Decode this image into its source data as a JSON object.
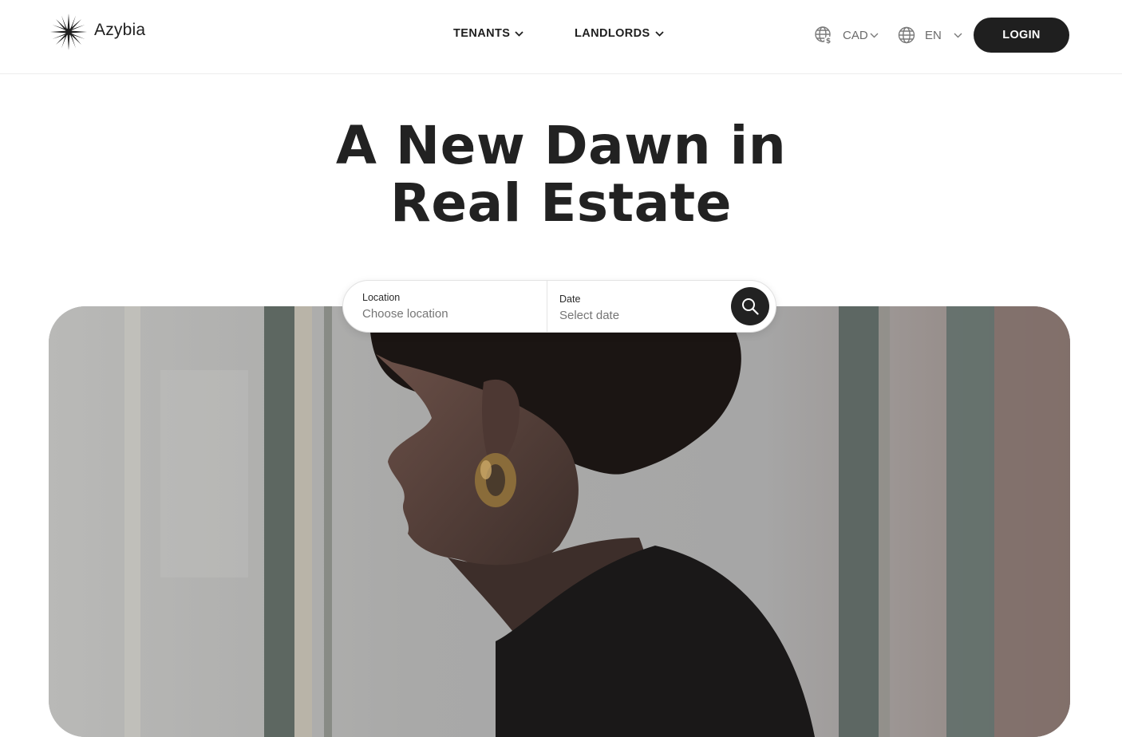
{
  "brand": {
    "name": "Azybia"
  },
  "nav": {
    "tenants": "TENANTS",
    "landlords": "LANDLORDS"
  },
  "preferences": {
    "currency": "CAD",
    "language": "EN"
  },
  "login_label": "LOGIN",
  "hero": {
    "title_line1": "A New Dawn in",
    "title_line2": "Real Estate"
  },
  "search": {
    "location_label": "Location",
    "location_placeholder": "Choose location",
    "date_label": "Date",
    "date_placeholder": "Select date"
  },
  "icons": {
    "logo": "starburst-logo-icon",
    "currency": "globe-dollar-icon",
    "language": "globe-icon",
    "dropdown": "chevron-down-icon",
    "search": "search-icon"
  },
  "colors": {
    "primary": "#1f1f1f",
    "background": "#ffffff",
    "muted_text": "#6b6b6b"
  }
}
